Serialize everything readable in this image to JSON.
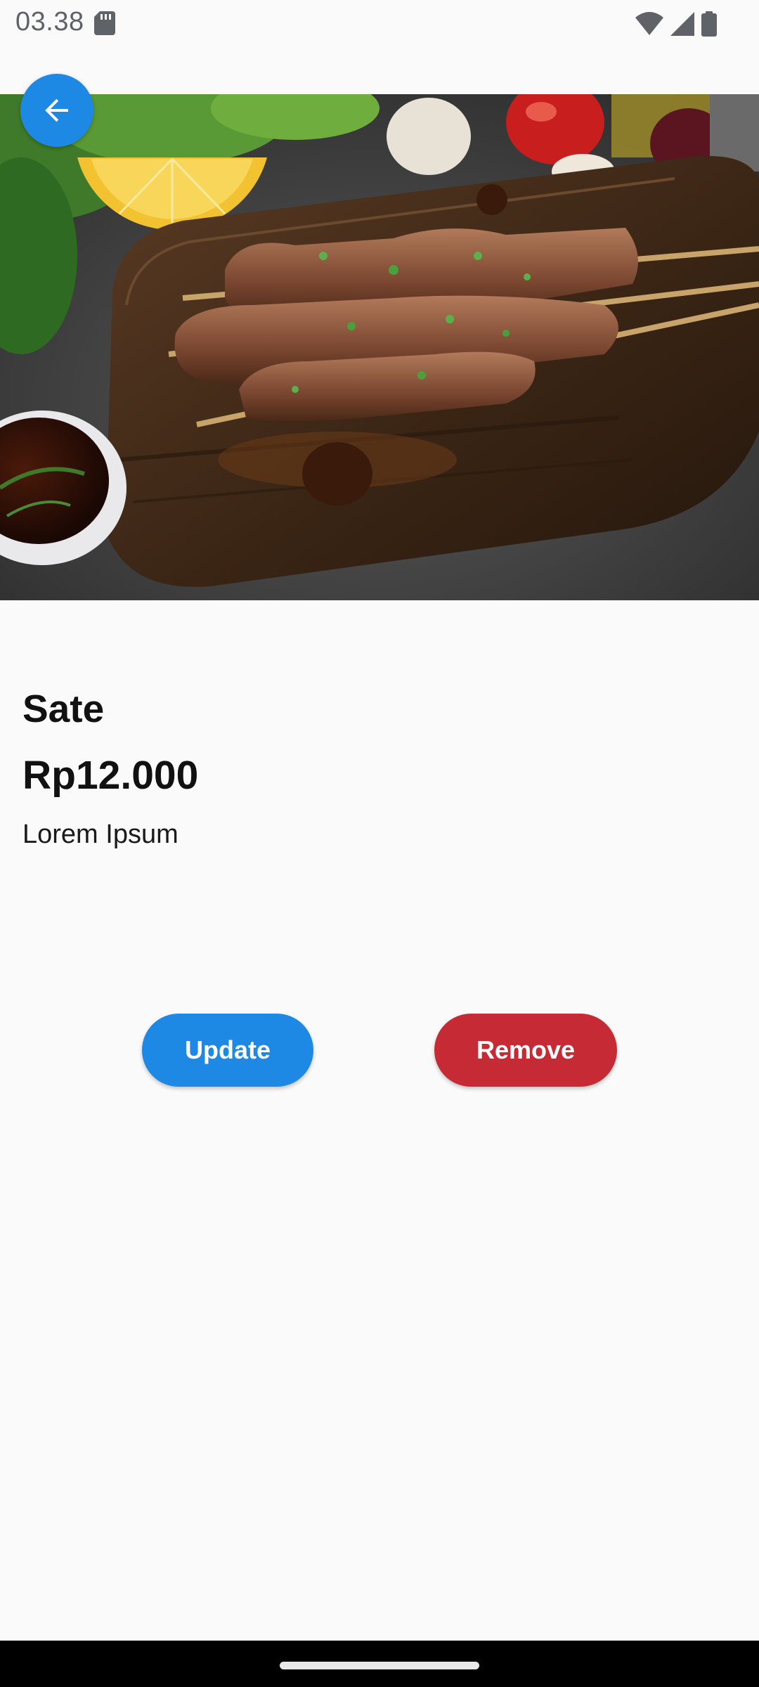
{
  "status_bar": {
    "time": "03.38",
    "icons": [
      "sd-card-icon",
      "wifi-icon",
      "signal-icon",
      "battery-icon"
    ]
  },
  "header": {
    "back_icon": "arrow-left-icon"
  },
  "hero_image": {
    "subject": "food-photo",
    "alt": "Sate"
  },
  "product": {
    "name": "Sate",
    "price": "Rp12.000",
    "description": "Lorem Ipsum"
  },
  "actions": {
    "update_label": "Update",
    "remove_label": "Remove"
  },
  "colors": {
    "primary": "#1e88e5",
    "danger": "#c62b35",
    "background": "#fafafa",
    "text": "#111111"
  }
}
